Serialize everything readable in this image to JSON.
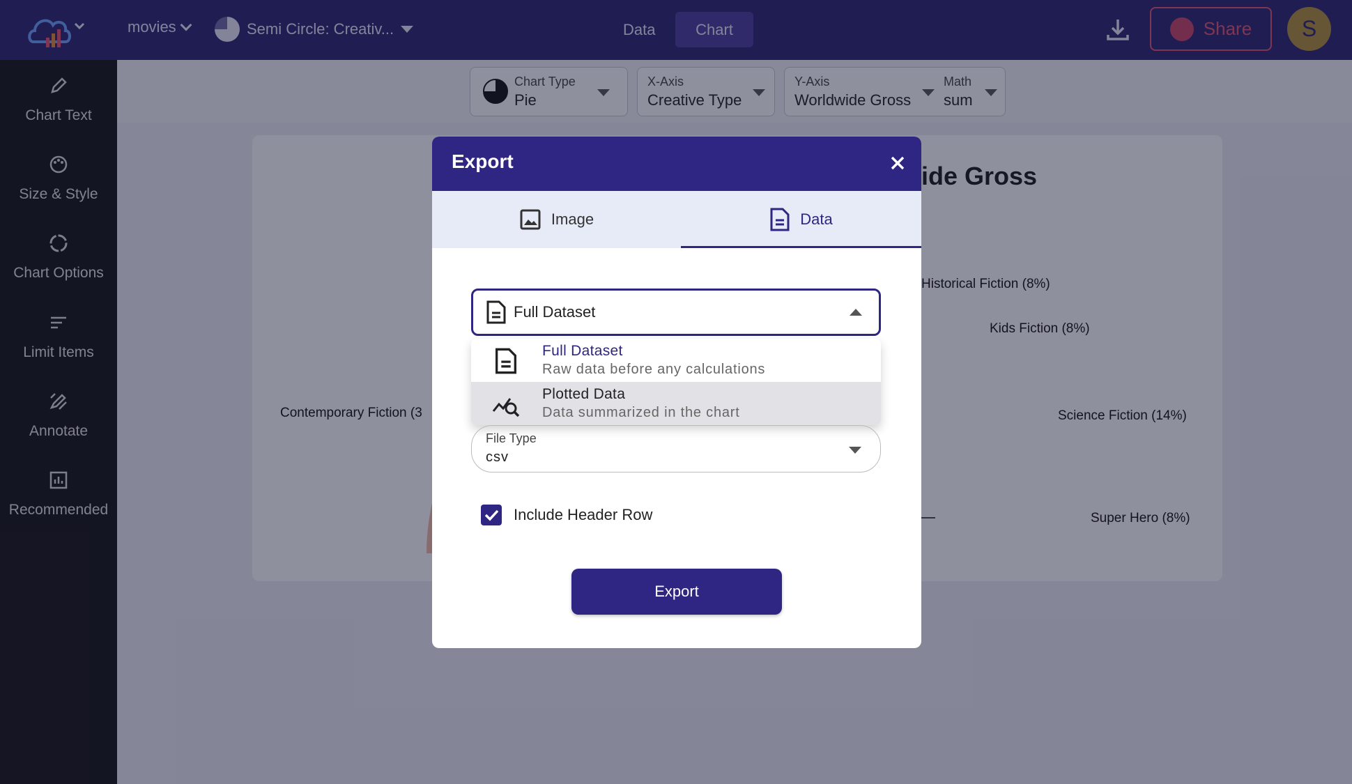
{
  "topbar": {
    "dataset_label": "movies",
    "chart_name": "Semi Circle: Creativ...",
    "tabs": [
      {
        "label": "Data",
        "active": false
      },
      {
        "label": "Chart",
        "active": true
      }
    ],
    "share_label": "Share",
    "avatar_initial": "S",
    "icons": [
      "cloud-chart-logo-icon",
      "download-icon",
      "globe-icon"
    ],
    "colors": {
      "bar": "#2b2472",
      "share": "#e0546f",
      "avatar": "#b3913a"
    }
  },
  "sidebar": {
    "items": [
      {
        "label": "Chart Text",
        "icon": "pencil-icon"
      },
      {
        "label": "Size & Style",
        "icon": "palette-icon"
      },
      {
        "label": "Chart Options",
        "icon": "circle-options-icon"
      },
      {
        "label": "Limit Items",
        "icon": "lines-icon"
      },
      {
        "label": "Annotate",
        "icon": "annotate-icon"
      },
      {
        "label": "Recommended",
        "icon": "recommended-chart-icon"
      }
    ]
  },
  "toolbar": {
    "chart_type": {
      "label": "Chart Type",
      "value": "Pie"
    },
    "x_axis": {
      "label": "X-Axis",
      "value": "Creative Type"
    },
    "y_axis": {
      "label": "Y-Axis",
      "value": "Worldwide Gross"
    },
    "math": {
      "label": "Math",
      "value": "sum"
    }
  },
  "chart": {
    "title_fragment": "ide Gross",
    "labels": {
      "historical": "Historical Fiction (8%)",
      "kids": "Kids Fiction (8%)",
      "science": "Science Fiction (14%)",
      "superhero": "Super Hero (8%)",
      "contemporary": "Contemporary Fiction (3"
    }
  },
  "modal": {
    "title": "Export",
    "tabs": [
      {
        "label": "Image",
        "icon": "image-icon"
      },
      {
        "label": "Data",
        "icon": "document-icon",
        "active": true
      }
    ],
    "dataset_select": {
      "value": "Full Dataset",
      "options": [
        {
          "title": "Full Dataset",
          "subtitle": "Raw data before any calculations",
          "icon": "document-icon"
        },
        {
          "title": "Plotted Data",
          "subtitle": "Data summarized in the chart",
          "icon": "chart-search-icon"
        }
      ]
    },
    "file_type": {
      "label": "File Type",
      "value": "csv"
    },
    "include_header": {
      "label": "Include Header Row",
      "checked": true
    },
    "export_label": "Export"
  }
}
